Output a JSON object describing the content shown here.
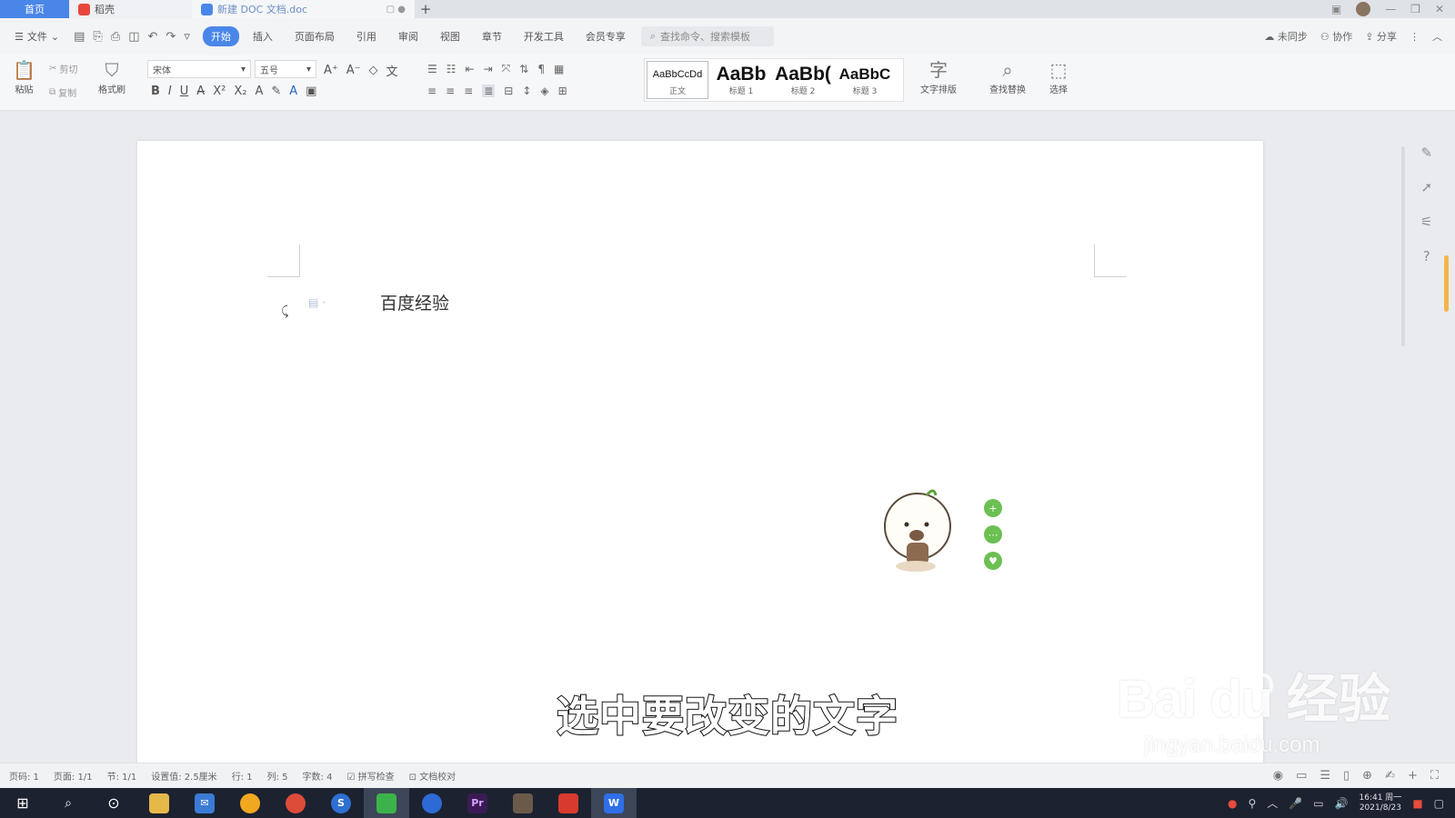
{
  "tabs": [
    {
      "label": "首页"
    },
    {
      "label": "稻壳"
    },
    {
      "label": "新建 DOC 文档.doc"
    }
  ],
  "menu": {
    "file_label": "文件",
    "items": [
      "开始",
      "插入",
      "页面布局",
      "引用",
      "审阅",
      "视图",
      "章节",
      "开发工具",
      "会员专享"
    ],
    "active_index": 0,
    "search_placeholder": "查找命令、搜索模板",
    "sync_label": "未同步",
    "collab_label": "协作",
    "share_label": "分享"
  },
  "ribbon": {
    "paste_label": "粘贴",
    "cut_label": "剪切",
    "copy_label": "复制",
    "format_painter_label": "格式刷",
    "font_name": "宋体",
    "font_size": "五号",
    "styles": [
      {
        "preview": "AaBbCcDd",
        "name": "正文"
      },
      {
        "preview": "AaBb",
        "name": "标题 1"
      },
      {
        "preview": "AaBb(",
        "name": "标题 2"
      },
      {
        "preview": "AaBbC",
        "name": "标题 3"
      }
    ],
    "text_layout_label": "文字排版",
    "find_replace_label": "查找替换",
    "select_label": "选择"
  },
  "document": {
    "text": "百度经验"
  },
  "subtitle": "选中要改变的文字",
  "watermark": {
    "brand": "Bai du 经验",
    "url": "jingyan.baidu.com"
  },
  "status": {
    "page_no": "页码: 1",
    "pages": "页面: 1/1",
    "section": "节: 1/1",
    "setting": "设置值: 2.5厘米",
    "row": "行: 1",
    "col": "列: 5",
    "words": "字数: 4",
    "spell_check": "拼写检查",
    "proofread": "文档校对"
  },
  "taskbar": {
    "clock_time": "16:41 周一",
    "clock_date": "2021/8/23"
  },
  "colors": {
    "accent": "#4a86e8",
    "mascot_button": "#6cc052",
    "taskbar": "#1c2230"
  }
}
